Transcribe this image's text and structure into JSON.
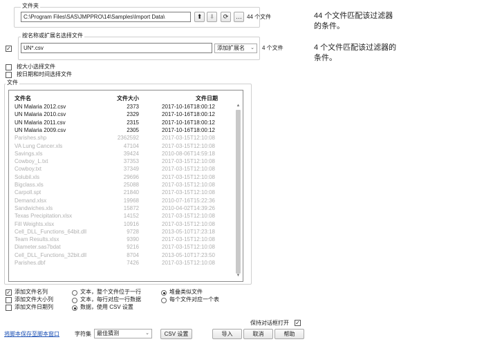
{
  "folder_group": {
    "title": "文件夹",
    "path": "C:\\Program Files\\SAS\\JMPPRO\\14\\Samples\\Import Data\\",
    "count": "44 个文件"
  },
  "filter_group": {
    "title": "按名称或扩展名选择文件",
    "checked": true,
    "pattern": "UN*.csv",
    "add_ext_label": "添加扩展名",
    "count": "4 个文件"
  },
  "options": {
    "by_size": "按大小选择文件",
    "by_date": "按日期和时间选择文件"
  },
  "files_group": {
    "title": "文件",
    "headers": {
      "name": "文件名",
      "size": "文件大小",
      "date": "文件日期"
    },
    "rows": [
      {
        "name": "UN Malaria 2012.csv",
        "size": "2373",
        "date": "2017-10-16T18:00:12",
        "match": true
      },
      {
        "name": "UN Malaria 2010.csv",
        "size": "2329",
        "date": "2017-10-16T18:00:12",
        "match": true
      },
      {
        "name": "UN Malaria 2011.csv",
        "size": "2315",
        "date": "2017-10-16T18:00:12",
        "match": true
      },
      {
        "name": "UN Malaria 2009.csv",
        "size": "2305",
        "date": "2017-10-16T18:00:12",
        "match": true
      },
      {
        "name": "Parishes.shp",
        "size": "2362592",
        "date": "2017-03-15T12:10:08",
        "match": false
      },
      {
        "name": "VA Lung Cancer.xls",
        "size": "47104",
        "date": "2017-03-15T12:10:08",
        "match": false
      },
      {
        "name": "Savings.xls",
        "size": "39424",
        "date": "2010-08-06T14:59:18",
        "match": false
      },
      {
        "name": "Cowboy_L.txt",
        "size": "37353",
        "date": "2017-03-15T12:10:08",
        "match": false
      },
      {
        "name": "Cowboy.txt",
        "size": "37349",
        "date": "2017-03-15T12:10:08",
        "match": false
      },
      {
        "name": "Solubil.xls",
        "size": "29696",
        "date": "2017-03-15T12:10:08",
        "match": false
      },
      {
        "name": "Bigclass.xls",
        "size": "25088",
        "date": "2017-03-15T12:10:08",
        "match": false
      },
      {
        "name": "Carpoll.spt",
        "size": "21840",
        "date": "2017-03-15T12:10:08",
        "match": false
      },
      {
        "name": "Demand.xlsx",
        "size": "19968",
        "date": "2010-07-16T15:22:36",
        "match": false
      },
      {
        "name": "Sandwiches.xls",
        "size": "15872",
        "date": "2010-04-02T14:39:26",
        "match": false
      },
      {
        "name": "Texas Precipitation.xlsx",
        "size": "14152",
        "date": "2017-03-15T12:10:08",
        "match": false
      },
      {
        "name": "Fill Weights.xlsx",
        "size": "10916",
        "date": "2017-03-15T12:10:08",
        "match": false
      },
      {
        "name": "Cell_DLL_Functions_64bit.dll",
        "size": "9728",
        "date": "2013-05-10T17:23:18",
        "match": false
      },
      {
        "name": "Team Results.xlsx",
        "size": "9390",
        "date": "2017-03-15T12:10:08",
        "match": false
      },
      {
        "name": "Diameter.sas7bdat",
        "size": "9216",
        "date": "2017-03-15T12:10:08",
        "match": false
      },
      {
        "name": "Cell_DLL_Functions_32bit.dll",
        "size": "8704",
        "date": "2013-05-10T17:23:50",
        "match": false
      },
      {
        "name": "Parishes.dbf",
        "size": "7426",
        "date": "2017-03-15T12:10:08",
        "match": false
      }
    ]
  },
  "bottom": {
    "add_name_col": "添加文件名列",
    "add_size_col": "添加文件大小列",
    "add_date_col": "添加文件日期列",
    "radio_text_whole": "文本，整个文件位于一行",
    "radio_text_line": "文本，每行对应一行数据",
    "radio_data_csv": "数据，使用 CSV 设置",
    "radio_stack": "堆叠类似文件",
    "radio_each": "每个文件对应一个表",
    "keep_open": "保持对话框打开",
    "save_script": "将脚本保存至脚本窗口",
    "charset_label": "字符集",
    "charset_value": "最佳猜测",
    "csv_settings": "CSV 设置",
    "import": "导入",
    "cancel": "取消",
    "help": "帮助"
  },
  "annotations": {
    "top_note": "44 个文件匹配该过滤器的条件。",
    "bottom_note": "4 个文件匹配该过滤器的条件。"
  }
}
